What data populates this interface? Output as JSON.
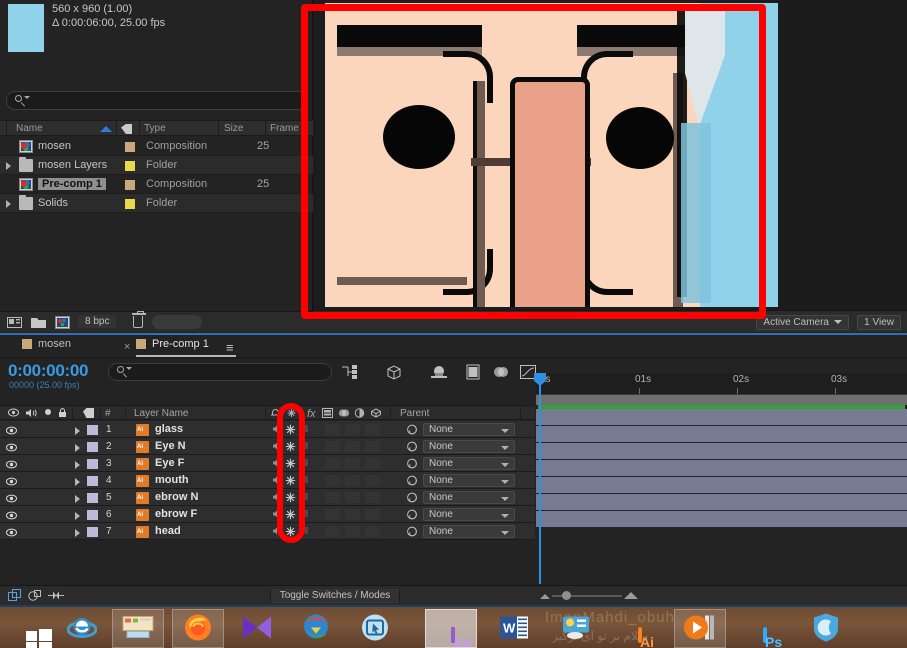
{
  "project_panel": {
    "info_lines": [
      "560 x 960 (1.00)",
      "Δ 0:00:06:00, 25.00 fps"
    ],
    "search_placeholder": "",
    "columns": [
      "Name",
      "Type",
      "Size",
      "Frame"
    ],
    "items": [
      {
        "name": "mosen",
        "type": "Composition",
        "size": "",
        "frame": "25",
        "kind": "comp",
        "expandable": false,
        "selected": false,
        "swatch": "#c9a87c"
      },
      {
        "name": "mosen Layers",
        "type": "Folder",
        "size": "",
        "frame": "",
        "kind": "folder",
        "expandable": true,
        "selected": false,
        "swatch": "#e8d84a"
      },
      {
        "name": "Pre-comp 1",
        "type": "Composition",
        "size": "",
        "frame": "25",
        "kind": "comp",
        "expandable": false,
        "selected": true,
        "swatch": "#c9a87c"
      },
      {
        "name": "Solids",
        "type": "Folder",
        "size": "",
        "frame": "",
        "kind": "folder",
        "expandable": true,
        "selected": false,
        "swatch": "#e8d84a"
      }
    ],
    "footer": {
      "bit_depth": "8 bpc",
      "icons": [
        "interpret-footage-icon",
        "new-folder-icon",
        "new-composition-icon",
        "delete-icon"
      ]
    }
  },
  "viewer": {
    "camera_label": "Active Camera",
    "view_label": "1 View",
    "toolbar_icons": [
      "magnification-icon",
      "channel-icon",
      "resolution-icon",
      "region-of-interest-icon",
      "transparency-grid-icon",
      "toggle-mask-icon",
      "timecode-icon",
      "snapshot-icon",
      "show-snapshot-icon"
    ]
  },
  "timeline": {
    "tabs": [
      {
        "label": "mosen",
        "active": false,
        "closeable": false
      },
      {
        "label": "Pre-comp 1",
        "active": true,
        "closeable": true
      }
    ],
    "menu_glyph": "≡",
    "timecode": "0:00:00:00",
    "timecode_sub": "00000 (25.00 fps)",
    "search_placeholder": "",
    "tool_icons": [
      "composition-mini-flowchart-icon",
      "draft-3d-icon",
      "hide-shy-layers-icon",
      "frame-blending-icon",
      "motion-blur-icon",
      "graph-editor-icon"
    ],
    "column_headers": {
      "visibility": "eye-icon",
      "audio": "audio-icon",
      "solo": "solo-icon",
      "lock": "lock-icon",
      "label": "label-icon",
      "number": "#",
      "layer_name": "Layer Name",
      "switches": [
        "shy-icon",
        "collapse-transformations-icon",
        "fx-icon",
        "quality-icon",
        "effects-icon",
        "frame-blend-icon",
        "motion-blur-icon",
        "adjustment-layer-icon",
        "3d-layer-icon"
      ],
      "parent": "Parent"
    },
    "layers": [
      {
        "number": "1",
        "name": "glass",
        "parent": "None",
        "source_type": "ai"
      },
      {
        "number": "2",
        "name": "Eye N",
        "parent": "None",
        "source_type": "ai"
      },
      {
        "number": "3",
        "name": "Eye F",
        "parent": "None",
        "source_type": "ai"
      },
      {
        "number": "4",
        "name": "mouth",
        "parent": "None",
        "source_type": "ai"
      },
      {
        "number": "5",
        "name": "ebrow N",
        "parent": "None",
        "source_type": "ai"
      },
      {
        "number": "6",
        "name": "ebrow F",
        "parent": "None",
        "source_type": "ai"
      },
      {
        "number": "7",
        "name": "head",
        "parent": "None",
        "source_type": "ai"
      }
    ],
    "ruler_labels": [
      "0s",
      "01s",
      "02s",
      "03s"
    ],
    "footer": {
      "toggle_switches_label": "Toggle Switches / Modes",
      "icons": [
        "composition-switches-icon",
        "toggle-switches-modes-icon",
        "stretch-icon"
      ]
    }
  },
  "annotations": [
    {
      "name": "viewer-highlight",
      "color": "#fe0000",
      "shape": "rectangle"
    },
    {
      "name": "collapse-transformations-column-highlight",
      "color": "#fe0000",
      "shape": "rounded-rectangle"
    }
  ],
  "taskbar": {
    "watermark_1": "ImanMahdi_obuh",
    "watermark_2": "سلام بر تو ای ترکیز",
    "items": [
      {
        "name": "start-button",
        "label": "",
        "kind": "start"
      },
      {
        "name": "internet-explorer",
        "label": "e",
        "kind": "ie"
      },
      {
        "name": "file-explorer",
        "label": "",
        "kind": "explorer"
      },
      {
        "name": "firefox",
        "label": "",
        "kind": "firefox"
      },
      {
        "name": "media-player",
        "label": "",
        "kind": "play"
      },
      {
        "name": "internet-download-manager",
        "label": "",
        "kind": "idm"
      },
      {
        "name": "snipping-tool",
        "label": "",
        "kind": "snip"
      },
      {
        "name": "after-effects",
        "label": "Ae",
        "kind": "adobe",
        "active": true,
        "color": "#9b59d0",
        "bg": "#2a1a3a"
      },
      {
        "name": "microsoft-word",
        "label": "W",
        "kind": "word"
      },
      {
        "name": "control-panel",
        "label": "",
        "kind": "weather"
      },
      {
        "name": "illustrator",
        "label": "Ai",
        "kind": "adobe",
        "color": "#ff7f18",
        "bg": "#2b1a05"
      },
      {
        "name": "video-player",
        "label": "",
        "kind": "vlcplay"
      },
      {
        "name": "photoshop",
        "label": "Ps",
        "kind": "adobe",
        "color": "#31a8ff",
        "bg": "#041c2e"
      },
      {
        "name": "vpn-shield",
        "label": "",
        "kind": "shield"
      }
    ]
  }
}
